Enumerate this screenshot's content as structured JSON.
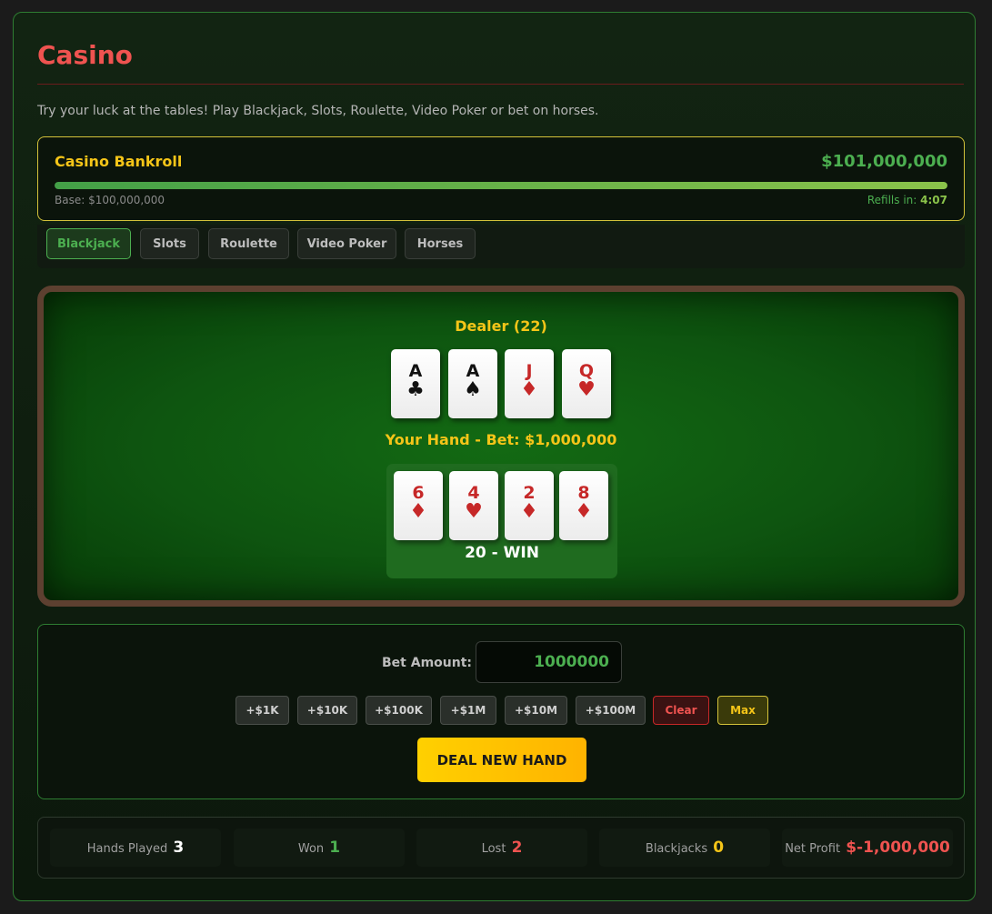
{
  "page": {
    "title": "Casino",
    "intro": "Try your luck at the tables! Play Blackjack, Slots, Roulette, Video Poker or bet on horses."
  },
  "bankroll": {
    "label": "Casino Bankroll",
    "amount": "$101,000,000",
    "base": "Base: $100,000,000",
    "refill_label": "Refills in:",
    "refill_time": "4:07",
    "fill_fraction": 1.0
  },
  "tabs": [
    {
      "label": "Blackjack",
      "active": true
    },
    {
      "label": "Slots",
      "active": false
    },
    {
      "label": "Roulette",
      "active": false
    },
    {
      "label": "Video Poker",
      "active": false
    },
    {
      "label": "Horses",
      "active": false
    }
  ],
  "blackjack": {
    "dealer_label": "Dealer (22)",
    "dealer_cards": [
      {
        "rank": "A",
        "suit": "♣",
        "color": "black"
      },
      {
        "rank": "A",
        "suit": "♠",
        "color": "black"
      },
      {
        "rank": "J",
        "suit": "♦",
        "color": "red"
      },
      {
        "rank": "Q",
        "suit": "♥",
        "color": "red"
      }
    ],
    "player_label": "Your Hand - Bet: $1,000,000",
    "player_cards": [
      {
        "rank": "6",
        "suit": "♦",
        "color": "red"
      },
      {
        "rank": "4",
        "suit": "♥",
        "color": "red"
      },
      {
        "rank": "2",
        "suit": "♦",
        "color": "red"
      },
      {
        "rank": "8",
        "suit": "♦",
        "color": "red"
      }
    ],
    "player_result": "20 - WIN"
  },
  "bet": {
    "label": "Bet Amount:",
    "value": "1000000",
    "chips": [
      "+$1K",
      "+$10K",
      "+$100K",
      "+$1M",
      "+$10M",
      "+$100M"
    ],
    "clear_label": "Clear",
    "max_label": "Max",
    "deal_label": "DEAL NEW HAND"
  },
  "stats": {
    "hands_played": {
      "label": "Hands Played",
      "value": "3"
    },
    "won": {
      "label": "Won",
      "value": "1"
    },
    "lost": {
      "label": "Lost",
      "value": "2"
    },
    "blackjacks": {
      "label": "Blackjacks",
      "value": "0"
    },
    "net_profit": {
      "label": "Net Profit",
      "value": "$-1,000,000"
    }
  },
  "colors": {
    "accent_green": "#4caf50",
    "gold": "#f5c518",
    "red": "#ef5350",
    "white": "#ffffff"
  }
}
